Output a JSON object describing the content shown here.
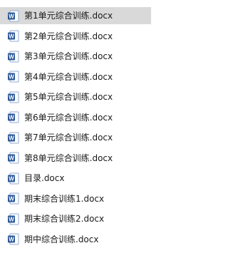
{
  "files": [
    {
      "name": "第1单元综合训练.docx",
      "icon": "word-doc-icon",
      "selected": true
    },
    {
      "name": "第2单元综合训练.docx",
      "icon": "word-doc-icon",
      "selected": false
    },
    {
      "name": "第3单元综合训练.docx",
      "icon": "word-doc-icon",
      "selected": false
    },
    {
      "name": "第4单元综合训练.docx",
      "icon": "word-doc-icon",
      "selected": false
    },
    {
      "name": "第5单元综合训练.docx",
      "icon": "word-doc-icon",
      "selected": false
    },
    {
      "name": "第6单元综合训练.docx",
      "icon": "word-doc-icon",
      "selected": false
    },
    {
      "name": "第7单元综合训练.docx",
      "icon": "word-doc-icon",
      "selected": false
    },
    {
      "name": "第8单元综合训练.docx",
      "icon": "word-doc-icon",
      "selected": false
    },
    {
      "name": "目录.docx",
      "icon": "word-doc-icon",
      "selected": false
    },
    {
      "name": "期末综合训练1.docx",
      "icon": "word-doc-icon",
      "selected": false
    },
    {
      "name": "期末综合训练2.docx",
      "icon": "word-doc-icon",
      "selected": false
    },
    {
      "name": "期中综合训练.docx",
      "icon": "word-doc-icon",
      "selected": false
    }
  ],
  "colors": {
    "selected_background": "#d9d9d9",
    "word_blue": "#2b5797",
    "word_blue_light": "#4472c4"
  }
}
